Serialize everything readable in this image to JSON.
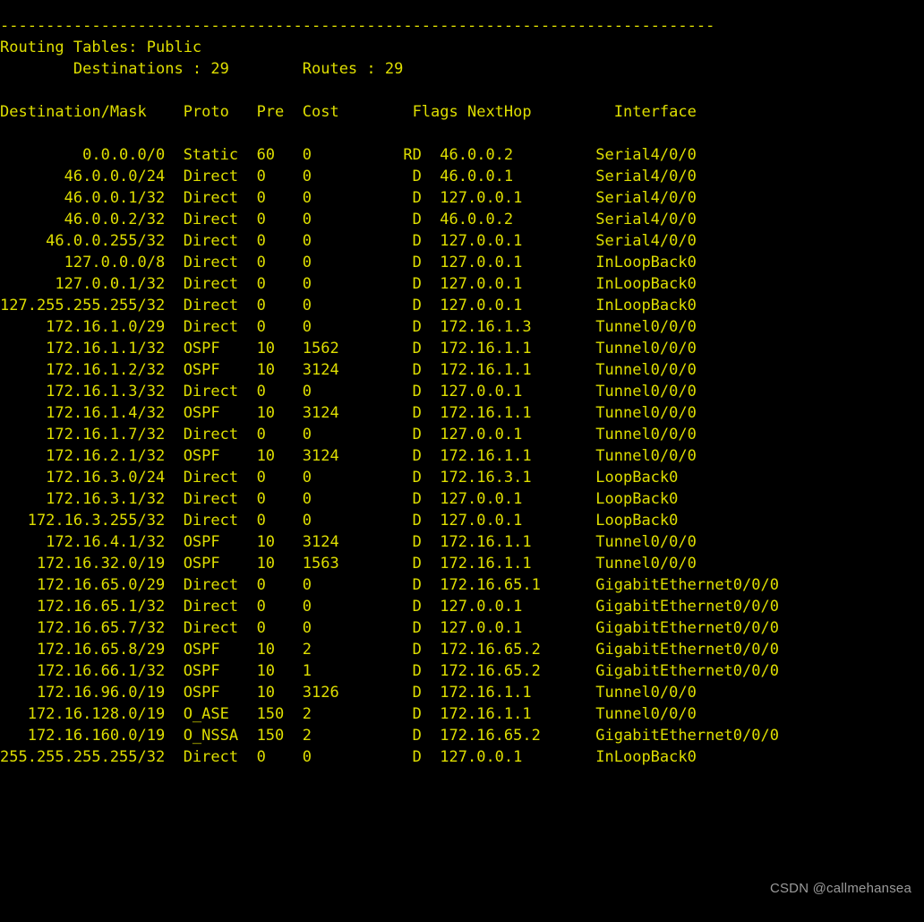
{
  "terminal": {
    "colors": {
      "background": "#000000",
      "text": "#dede00",
      "watermark": "#9a9a9a"
    },
    "separator": "------------------------------------------------------------------------------",
    "title_line": "Routing Tables: Public",
    "summary": {
      "destinations_label": "Destinations",
      "destinations_value": "29",
      "routes_label": "Routes",
      "routes_value": "29",
      "line": "        Destinations : 29        Routes : 29"
    },
    "columns": {
      "destination_mask": "Destination/Mask",
      "proto": "Proto",
      "pre": "Pre",
      "cost": "Cost",
      "flags": "Flags",
      "nexthop": "NextHop",
      "interface": "Interface",
      "header_line": "Destination/Mask    Proto   Pre  Cost        Flags NextHop         Interface"
    },
    "rows": [
      {
        "destination": "0.0.0.0/0",
        "proto": "Static",
        "pre": "60",
        "cost": "0",
        "flags": "RD",
        "nexthop": "46.0.0.2",
        "interface": "Serial4/0/0"
      },
      {
        "destination": "46.0.0.0/24",
        "proto": "Direct",
        "pre": "0",
        "cost": "0",
        "flags": "D",
        "nexthop": "46.0.0.1",
        "interface": "Serial4/0/0"
      },
      {
        "destination": "46.0.0.1/32",
        "proto": "Direct",
        "pre": "0",
        "cost": "0",
        "flags": "D",
        "nexthop": "127.0.0.1",
        "interface": "Serial4/0/0"
      },
      {
        "destination": "46.0.0.2/32",
        "proto": "Direct",
        "pre": "0",
        "cost": "0",
        "flags": "D",
        "nexthop": "46.0.0.2",
        "interface": "Serial4/0/0"
      },
      {
        "destination": "46.0.0.255/32",
        "proto": "Direct",
        "pre": "0",
        "cost": "0",
        "flags": "D",
        "nexthop": "127.0.0.1",
        "interface": "Serial4/0/0"
      },
      {
        "destination": "127.0.0.0/8",
        "proto": "Direct",
        "pre": "0",
        "cost": "0",
        "flags": "D",
        "nexthop": "127.0.0.1",
        "interface": "InLoopBack0"
      },
      {
        "destination": "127.0.0.1/32",
        "proto": "Direct",
        "pre": "0",
        "cost": "0",
        "flags": "D",
        "nexthop": "127.0.0.1",
        "interface": "InLoopBack0"
      },
      {
        "destination": "127.255.255.255/32",
        "proto": "Direct",
        "pre": "0",
        "cost": "0",
        "flags": "D",
        "nexthop": "127.0.0.1",
        "interface": "InLoopBack0"
      },
      {
        "destination": "172.16.1.0/29",
        "proto": "Direct",
        "pre": "0",
        "cost": "0",
        "flags": "D",
        "nexthop": "172.16.1.3",
        "interface": "Tunnel0/0/0"
      },
      {
        "destination": "172.16.1.1/32",
        "proto": "OSPF",
        "pre": "10",
        "cost": "1562",
        "flags": "D",
        "nexthop": "172.16.1.1",
        "interface": "Tunnel0/0/0"
      },
      {
        "destination": "172.16.1.2/32",
        "proto": "OSPF",
        "pre": "10",
        "cost": "3124",
        "flags": "D",
        "nexthop": "172.16.1.1",
        "interface": "Tunnel0/0/0"
      },
      {
        "destination": "172.16.1.3/32",
        "proto": "Direct",
        "pre": "0",
        "cost": "0",
        "flags": "D",
        "nexthop": "127.0.0.1",
        "interface": "Tunnel0/0/0"
      },
      {
        "destination": "172.16.1.4/32",
        "proto": "OSPF",
        "pre": "10",
        "cost": "3124",
        "flags": "D",
        "nexthop": "172.16.1.1",
        "interface": "Tunnel0/0/0"
      },
      {
        "destination": "172.16.1.7/32",
        "proto": "Direct",
        "pre": "0",
        "cost": "0",
        "flags": "D",
        "nexthop": "127.0.0.1",
        "interface": "Tunnel0/0/0"
      },
      {
        "destination": "172.16.2.1/32",
        "proto": "OSPF",
        "pre": "10",
        "cost": "3124",
        "flags": "D",
        "nexthop": "172.16.1.1",
        "interface": "Tunnel0/0/0"
      },
      {
        "destination": "172.16.3.0/24",
        "proto": "Direct",
        "pre": "0",
        "cost": "0",
        "flags": "D",
        "nexthop": "172.16.3.1",
        "interface": "LoopBack0"
      },
      {
        "destination": "172.16.3.1/32",
        "proto": "Direct",
        "pre": "0",
        "cost": "0",
        "flags": "D",
        "nexthop": "127.0.0.1",
        "interface": "LoopBack0"
      },
      {
        "destination": "172.16.3.255/32",
        "proto": "Direct",
        "pre": "0",
        "cost": "0",
        "flags": "D",
        "nexthop": "127.0.0.1",
        "interface": "LoopBack0"
      },
      {
        "destination": "172.16.4.1/32",
        "proto": "OSPF",
        "pre": "10",
        "cost": "3124",
        "flags": "D",
        "nexthop": "172.16.1.1",
        "interface": "Tunnel0/0/0"
      },
      {
        "destination": "172.16.32.0/19",
        "proto": "OSPF",
        "pre": "10",
        "cost": "1563",
        "flags": "D",
        "nexthop": "172.16.1.1",
        "interface": "Tunnel0/0/0"
      },
      {
        "destination": "172.16.65.0/29",
        "proto": "Direct",
        "pre": "0",
        "cost": "0",
        "flags": "D",
        "nexthop": "172.16.65.1",
        "interface": "GigabitEthernet0/0/0"
      },
      {
        "destination": "172.16.65.1/32",
        "proto": "Direct",
        "pre": "0",
        "cost": "0",
        "flags": "D",
        "nexthop": "127.0.0.1",
        "interface": "GigabitEthernet0/0/0"
      },
      {
        "destination": "172.16.65.7/32",
        "proto": "Direct",
        "pre": "0",
        "cost": "0",
        "flags": "D",
        "nexthop": "127.0.0.1",
        "interface": "GigabitEthernet0/0/0"
      },
      {
        "destination": "172.16.65.8/29",
        "proto": "OSPF",
        "pre": "10",
        "cost": "2",
        "flags": "D",
        "nexthop": "172.16.65.2",
        "interface": "GigabitEthernet0/0/0"
      },
      {
        "destination": "172.16.66.1/32",
        "proto": "OSPF",
        "pre": "10",
        "cost": "1",
        "flags": "D",
        "nexthop": "172.16.65.2",
        "interface": "GigabitEthernet0/0/0"
      },
      {
        "destination": "172.16.96.0/19",
        "proto": "OSPF",
        "pre": "10",
        "cost": "3126",
        "flags": "D",
        "nexthop": "172.16.1.1",
        "interface": "Tunnel0/0/0"
      },
      {
        "destination": "172.16.128.0/19",
        "proto": "O_ASE",
        "pre": "150",
        "cost": "2",
        "flags": "D",
        "nexthop": "172.16.1.1",
        "interface": "Tunnel0/0/0"
      },
      {
        "destination": "172.16.160.0/19",
        "proto": "O_NSSA",
        "pre": "150",
        "cost": "2",
        "flags": "D",
        "nexthop": "172.16.65.2",
        "interface": "GigabitEthernet0/0/0"
      },
      {
        "destination": "255.255.255.255/32",
        "proto": "Direct",
        "pre": "0",
        "cost": "0",
        "flags": "D",
        "nexthop": "127.0.0.1",
        "interface": "InLoopBack0"
      }
    ],
    "watermark": "CSDN @callmehansea"
  }
}
